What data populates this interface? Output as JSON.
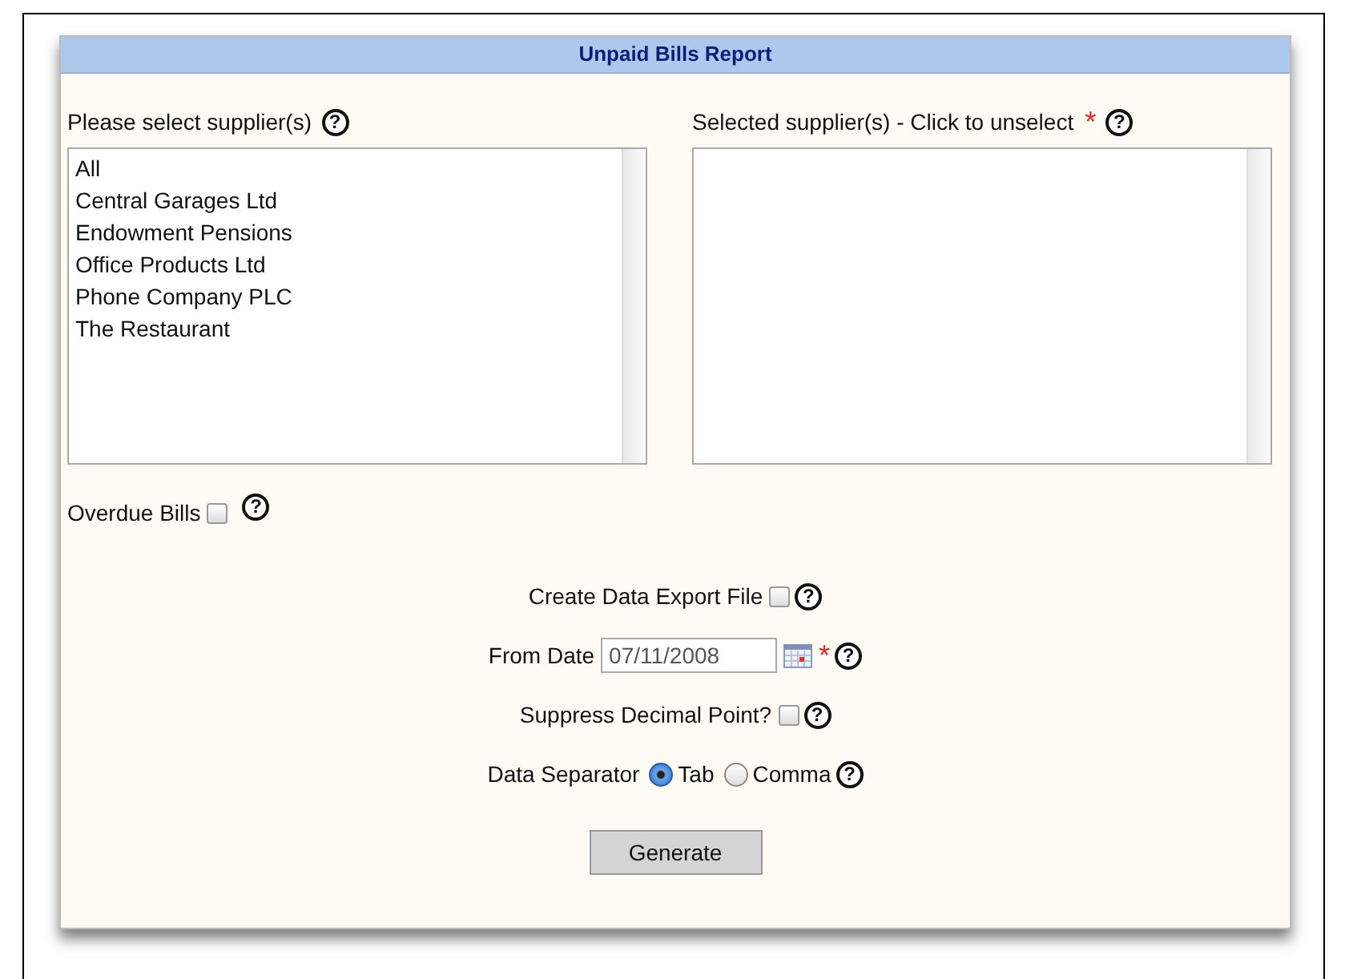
{
  "title": "Unpaid Bills Report",
  "available": {
    "label": "Please select supplier(s)",
    "help": "?",
    "items": [
      "All",
      "Central Garages Ltd",
      "Endowment Pensions",
      "Office Products Ltd",
      "Phone Company PLC",
      "The Restaurant"
    ]
  },
  "chosen": {
    "label": "Selected supplier(s) - Click to unselect",
    "required": "*",
    "help": "?"
  },
  "overdue": {
    "label": "Overdue Bills",
    "checked": false,
    "help": "?"
  },
  "options": [
    {
      "kind": "checkbox",
      "label": "Create Data Export File",
      "checked": false,
      "help": "?"
    },
    {
      "kind": "date",
      "label": "From Date",
      "value": "07/11/2008",
      "required": "*",
      "help": "?"
    },
    {
      "kind": "checkbox",
      "label": "Suppress Decimal Point?",
      "checked": false,
      "help": "?"
    },
    {
      "kind": "radio",
      "label": "Data Separator",
      "choices": [
        {
          "label": "Tab",
          "selected": true
        },
        {
          "label": "Comma",
          "selected": false
        }
      ],
      "help": "?"
    }
  ],
  "button": "Generate"
}
